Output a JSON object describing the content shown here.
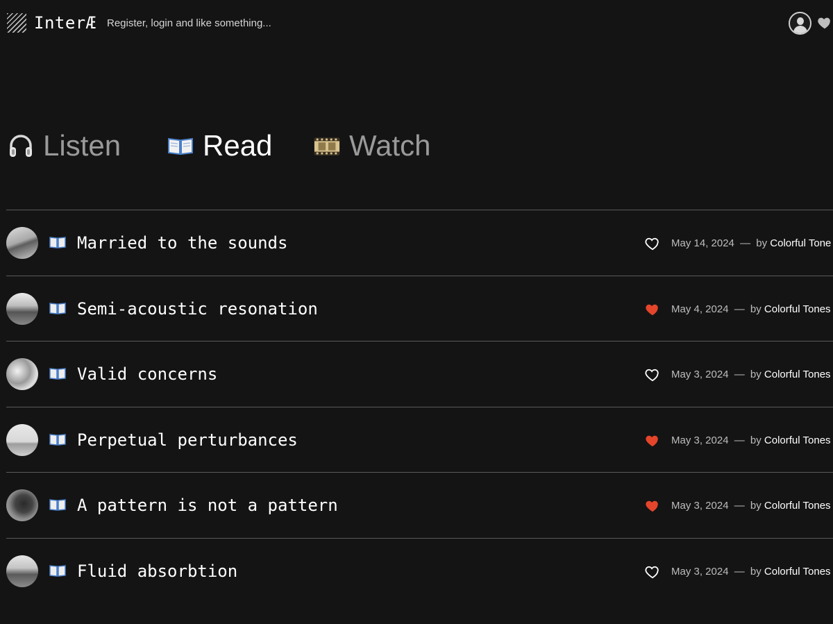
{
  "header": {
    "logo_text": "InterÆ",
    "tagline": "Register, login and like something..."
  },
  "tabs": [
    {
      "label": "Listen",
      "icon": "headphones-icon",
      "active": false
    },
    {
      "label": "Read",
      "icon": "open-book-icon",
      "active": true
    },
    {
      "label": "Watch",
      "icon": "film-icon",
      "active": false
    }
  ],
  "items": [
    {
      "title": "Married to the sounds",
      "date": "May 14, 2024",
      "dash": "—",
      "by": "by",
      "author": "Colorful Tone",
      "liked": false
    },
    {
      "title": "Semi-acoustic resonation",
      "date": "May 4, 2024",
      "dash": "—",
      "by": "by",
      "author": "Colorful Tones",
      "liked": true
    },
    {
      "title": "Valid concerns",
      "date": "May 3, 2024",
      "dash": "—",
      "by": "by",
      "author": "Colorful Tones",
      "liked": false
    },
    {
      "title": "Perpetual perturbances",
      "date": "May 3, 2024",
      "dash": "—",
      "by": "by",
      "author": "Colorful Tones",
      "liked": true
    },
    {
      "title": "A pattern is not a pattern",
      "date": "May 3, 2024",
      "dash": "—",
      "by": "by",
      "author": "Colorful Tones",
      "liked": true
    },
    {
      "title": "Fluid absorbtion",
      "date": "May 3, 2024",
      "dash": "—",
      "by": "by",
      "author": "Colorful Tones",
      "liked": false
    }
  ],
  "colors": {
    "background": "#141414",
    "liked_heart": "#e5452b",
    "divider": "#5a5a5a"
  }
}
